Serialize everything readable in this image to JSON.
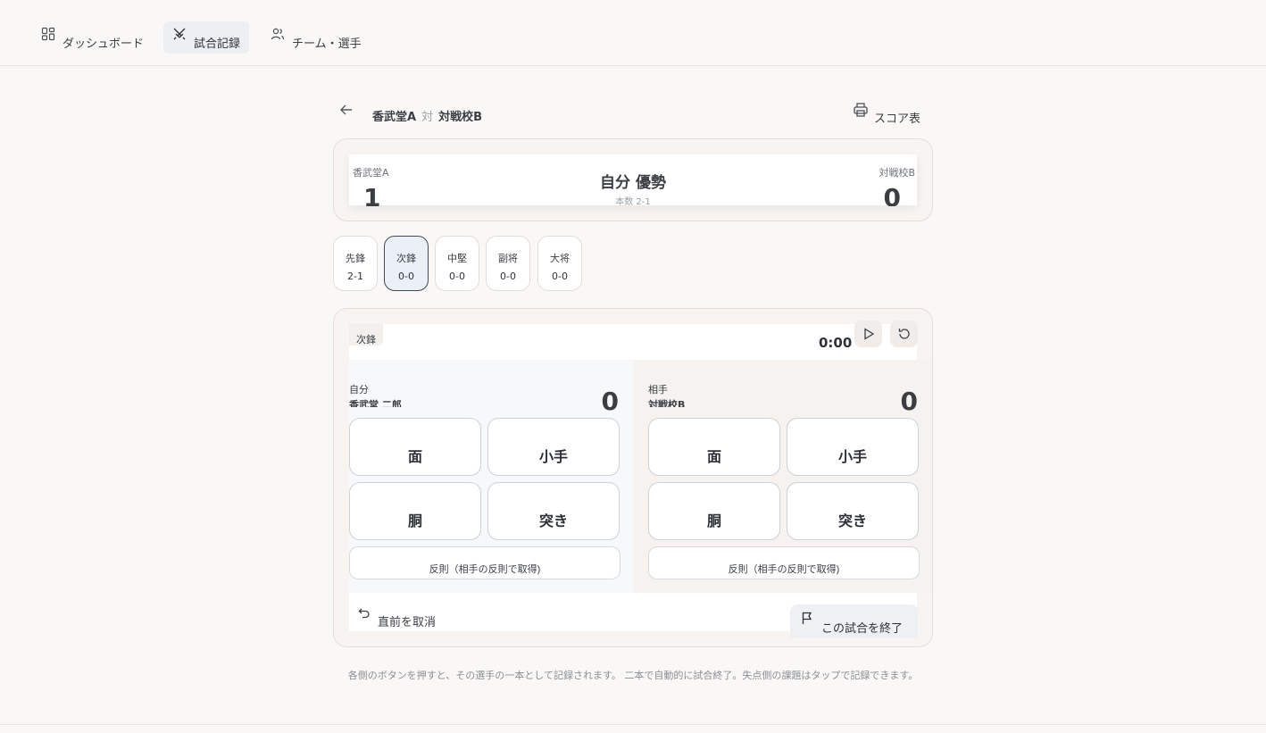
{
  "nav": {
    "items": [
      {
        "label": "ダッシュボード",
        "icon": "dashboard-icon"
      },
      {
        "label": "試合記録",
        "icon": "crossed-swords-icon",
        "active": true
      },
      {
        "label": "チーム・選手",
        "icon": "users-icon"
      }
    ]
  },
  "header": {
    "home_team": "香武堂A",
    "vs": "対",
    "away_team": "対戦校B",
    "scoresheet_label": "スコア表"
  },
  "scoreboard": {
    "home_name": "香武堂A",
    "home_score": "1",
    "away_name": "対戦校B",
    "away_score": "0",
    "status": "自分 優勢",
    "points": "本数 2-1"
  },
  "bouts": [
    {
      "position": "先鋒",
      "result": "2-1"
    },
    {
      "position": "次鋒",
      "result": "0-0",
      "active": true
    },
    {
      "position": "中堅",
      "result": "0-0"
    },
    {
      "position": "副将",
      "result": "0-0"
    },
    {
      "position": "大将",
      "result": "0-0"
    }
  ],
  "panel": {
    "position": "次鋒",
    "timer": "0:00",
    "self": {
      "role": "自分",
      "player": "香武堂 二郎",
      "score": "0",
      "waza": [
        "面",
        "小手",
        "胴",
        "突き"
      ],
      "foul_label": "反則（相手の反則で取得)"
    },
    "opponent": {
      "role": "相手",
      "player": "対戦校B",
      "score": "0",
      "waza": [
        "面",
        "小手",
        "胴",
        "突き"
      ],
      "foul_label": "反則（相手の反則で取得)"
    },
    "undo_label": "直前を取消",
    "end_label": "この試合を終了"
  },
  "footnote": "各側のボタンを押すと、その選手の一本として記録されます。 二本で自動的に試合終了。失点側の課題はタップで記録できます。"
}
